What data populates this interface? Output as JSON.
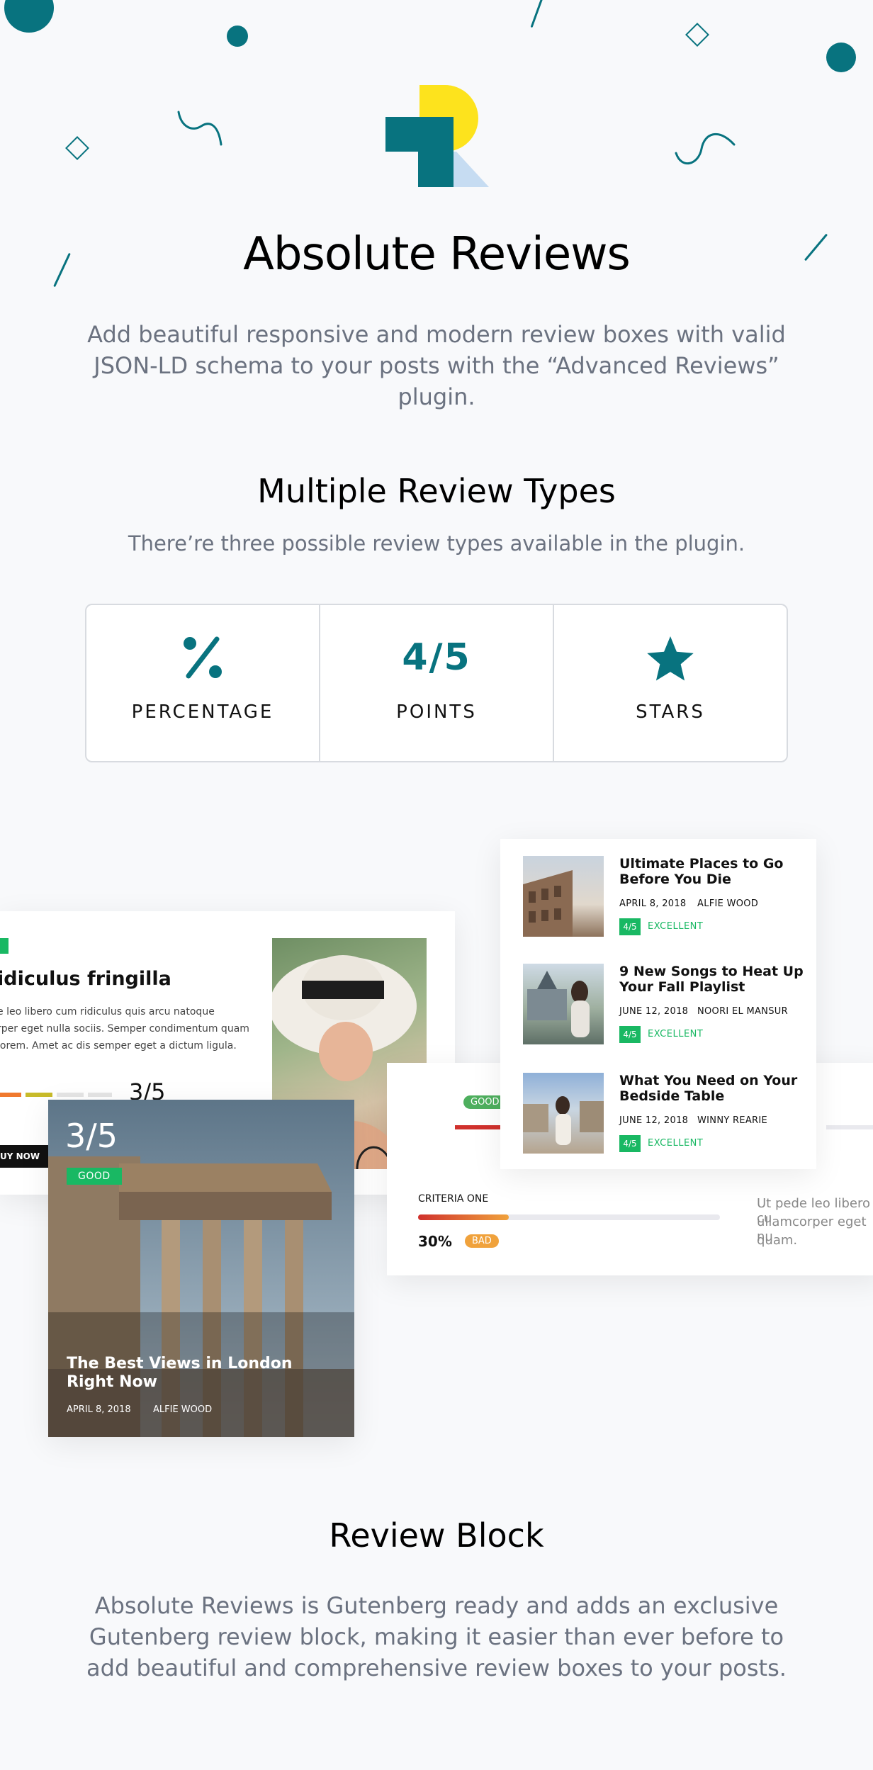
{
  "hero": {
    "title": "Absolute Reviews",
    "description": "Add beautiful responsive and modern review boxes with valid JSON-LD schema to your posts with the “Advanced Reviews” plugin."
  },
  "types_section": {
    "heading": "Multiple Review Types",
    "subheading": "There’re three possible review types available in the plugin.",
    "types": [
      {
        "label": "PERCENTAGE",
        "icon": "percent-icon"
      },
      {
        "label": "POINTS",
        "icon": "points-icon",
        "icon_text": "4/5"
      },
      {
        "label": "STARS",
        "icon": "star-icon"
      }
    ]
  },
  "preview": {
    "left_card": {
      "title": "idiculus fringilla",
      "excerpt": [
        "e leo libero cum ridiculus quis arcu natoque",
        "rper eget nulla sociis. Semper condimentum quam",
        "lorem. Amet ac dis semper eget a dictum ligula."
      ],
      "score": "3/5",
      "buy_label": "UY NOW"
    },
    "overlay_card": {
      "score": "3/5",
      "label": "GOOD",
      "title": "The Best Views in London Right Now",
      "date": "APRIL 8, 2018",
      "author": "ALFIE WOOD"
    },
    "criteria_card": {
      "badge": "GOOD",
      "criteria_label": "CRITERIA ONE",
      "percent": "30%",
      "percent_value": 30,
      "percent_label": "BAD",
      "side_text": [
        "Ut pede leo libero cu",
        "ullamcorper eget nu",
        "quam."
      ]
    },
    "list_card": {
      "items": [
        {
          "title": "Ultimate Places to Go Before You Die",
          "date": "APRIL 8, 2018",
          "author": "ALFIE WOOD",
          "score": "4/5",
          "label": "EXCELLENT"
        },
        {
          "title": "9 New Songs to Heat Up Your Fall Playlist",
          "date": "JUNE 12, 2018",
          "author": "NOORI EL MANSUR",
          "score": "4/5",
          "label": "EXCELLENT"
        },
        {
          "title": "What You Need on Your Bedside Table",
          "date": "JUNE 12, 2018",
          "author": "WINNY REARIE",
          "score": "4/5",
          "label": "EXCELLENT"
        }
      ]
    }
  },
  "block_section": {
    "heading": "Review Block",
    "description": "Absolute Reviews is Gutenberg ready and adds an exclusive Gutenberg review block, making it easier than ever before to add beautiful and comprehensive review boxes to your posts."
  },
  "colors": {
    "teal": "#08737f",
    "yellow": "#fde31d",
    "green": "#19b863",
    "orange": "#f0a23c",
    "red": "#d0312d"
  }
}
